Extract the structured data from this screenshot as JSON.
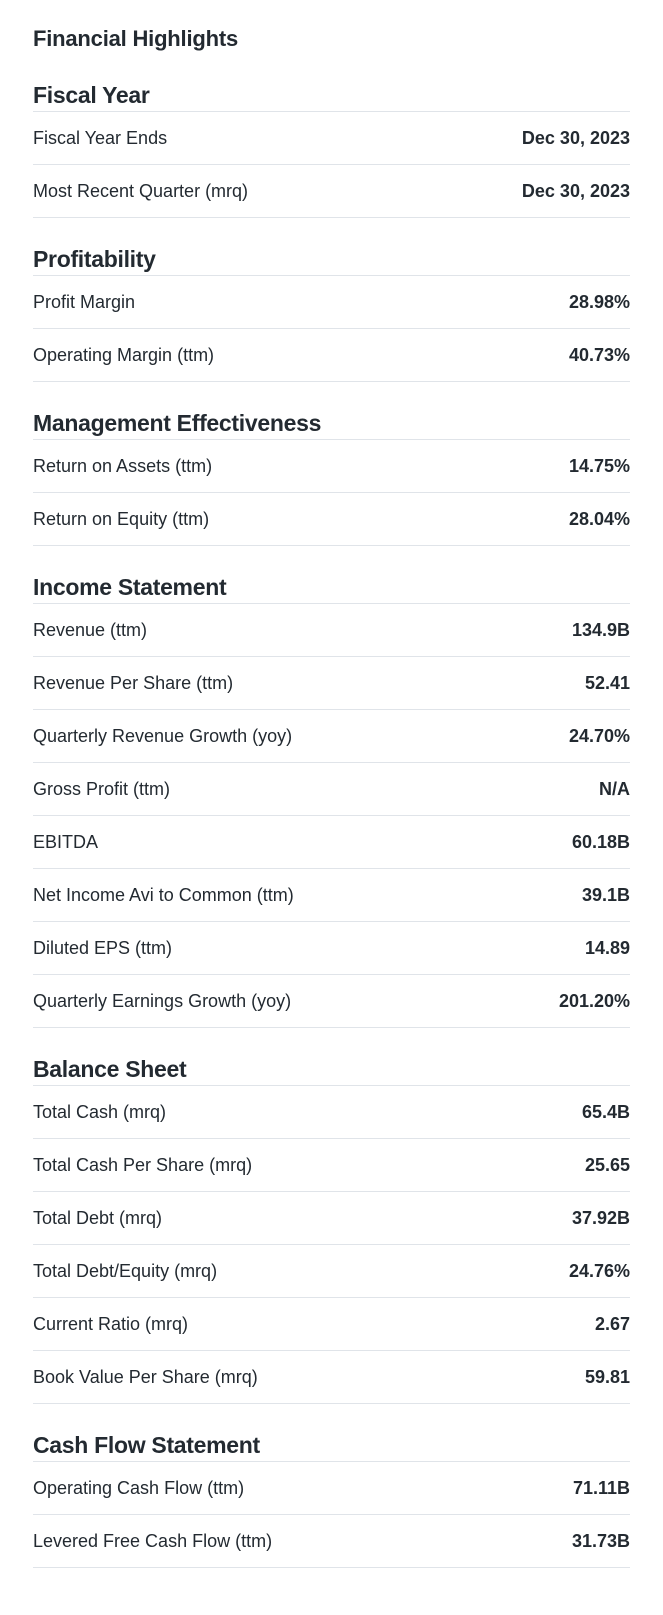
{
  "page_title": "Financial Highlights",
  "sections": [
    {
      "title": "Fiscal Year",
      "rows": [
        {
          "label": "Fiscal Year Ends",
          "value": "Dec 30, 2023"
        },
        {
          "label": "Most Recent Quarter (mrq)",
          "value": "Dec 30, 2023"
        }
      ]
    },
    {
      "title": "Profitability",
      "rows": [
        {
          "label": "Profit Margin",
          "value": "28.98%"
        },
        {
          "label": "Operating Margin (ttm)",
          "value": "40.73%"
        }
      ]
    },
    {
      "title": "Management Effectiveness",
      "rows": [
        {
          "label": "Return on Assets (ttm)",
          "value": "14.75%"
        },
        {
          "label": "Return on Equity (ttm)",
          "value": "28.04%"
        }
      ]
    },
    {
      "title": "Income Statement",
      "rows": [
        {
          "label": "Revenue (ttm)",
          "value": "134.9B"
        },
        {
          "label": "Revenue Per Share (ttm)",
          "value": "52.41"
        },
        {
          "label": "Quarterly Revenue Growth (yoy)",
          "value": "24.70%"
        },
        {
          "label": "Gross Profit (ttm)",
          "value": "N/A"
        },
        {
          "label": "EBITDA",
          "value": "60.18B"
        },
        {
          "label": "Net Income Avi to Common (ttm)",
          "value": "39.1B"
        },
        {
          "label": "Diluted EPS (ttm)",
          "value": "14.89"
        },
        {
          "label": "Quarterly Earnings Growth (yoy)",
          "value": "201.20%"
        }
      ]
    },
    {
      "title": "Balance Sheet",
      "rows": [
        {
          "label": "Total Cash (mrq)",
          "value": "65.4B"
        },
        {
          "label": "Total Cash Per Share (mrq)",
          "value": "25.65"
        },
        {
          "label": "Total Debt (mrq)",
          "value": "37.92B"
        },
        {
          "label": "Total Debt/Equity (mrq)",
          "value": "24.76%"
        },
        {
          "label": "Current Ratio (mrq)",
          "value": "2.67"
        },
        {
          "label": "Book Value Per Share (mrq)",
          "value": "59.81"
        }
      ]
    },
    {
      "title": "Cash Flow Statement",
      "rows": [
        {
          "label": "Operating Cash Flow (ttm)",
          "value": "71.11B"
        },
        {
          "label": "Levered Free Cash Flow (ttm)",
          "value": "31.73B"
        }
      ]
    }
  ]
}
